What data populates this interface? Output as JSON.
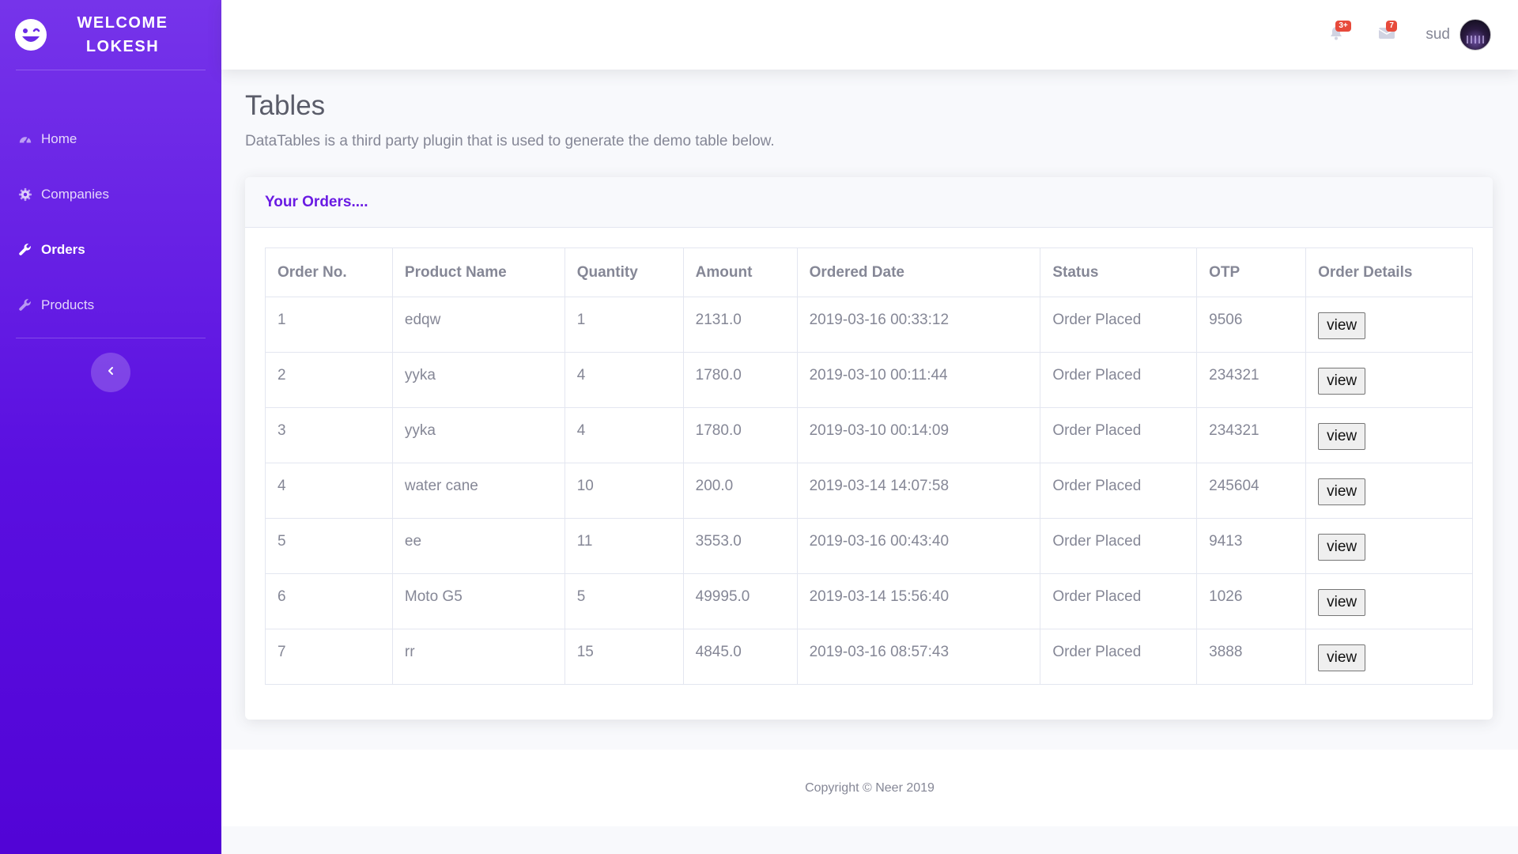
{
  "sidebar": {
    "brand": "WELCOME LOKESH",
    "items": [
      {
        "label": "Home",
        "icon": "dashboard-icon",
        "active": false
      },
      {
        "label": "Companies",
        "icon": "cog-icon",
        "active": false
      },
      {
        "label": "Orders",
        "icon": "wrench-icon",
        "active": true
      },
      {
        "label": "Products",
        "icon": "wrench-icon",
        "active": false
      }
    ],
    "toggle_icon": "chevron-left-icon"
  },
  "topbar": {
    "alerts_badge": "3+",
    "messages_badge": "7",
    "username": "sud"
  },
  "page": {
    "title": "Tables",
    "description": "DataTables is a third party plugin that is used to generate the demo table below."
  },
  "card": {
    "title": "Your Orders...."
  },
  "table": {
    "headers": [
      "Order No.",
      "Product Name",
      "Quantity",
      "Amount",
      "Ordered Date",
      "Status",
      "OTP",
      "Order Details"
    ],
    "rows": [
      [
        "1",
        "edqw",
        "1",
        "2131.0",
        "2019-03-16 00:33:12",
        "Order Placed",
        "9506"
      ],
      [
        "2",
        "yyka",
        "4",
        "1780.0",
        "2019-03-10 00:11:44",
        "Order Placed",
        "234321"
      ],
      [
        "3",
        "yyka",
        "4",
        "1780.0",
        "2019-03-10 00:14:09",
        "Order Placed",
        "234321"
      ],
      [
        "4",
        "water cane",
        "10",
        "200.0",
        "2019-03-14 14:07:58",
        "Order Placed",
        "245604"
      ],
      [
        "5",
        "ee",
        "11",
        "3553.0",
        "2019-03-16 00:43:40",
        "Order Placed",
        "9413"
      ],
      [
        "6",
        "Moto G5",
        "5",
        "49995.0",
        "2019-03-14 15:56:40",
        "Order Placed",
        "1026"
      ],
      [
        "7",
        "rr",
        "15",
        "4845.0",
        "2019-03-16 08:57:43",
        "Order Placed",
        "3888"
      ]
    ],
    "action_label": "view"
  },
  "footer": {
    "text": "Copyright © Neer 2019"
  },
  "colors": {
    "sidebar_top": "#7634ea",
    "sidebar_bottom": "#5204d6",
    "accent": "#6a1be3",
    "badge": "#e74a3b"
  }
}
